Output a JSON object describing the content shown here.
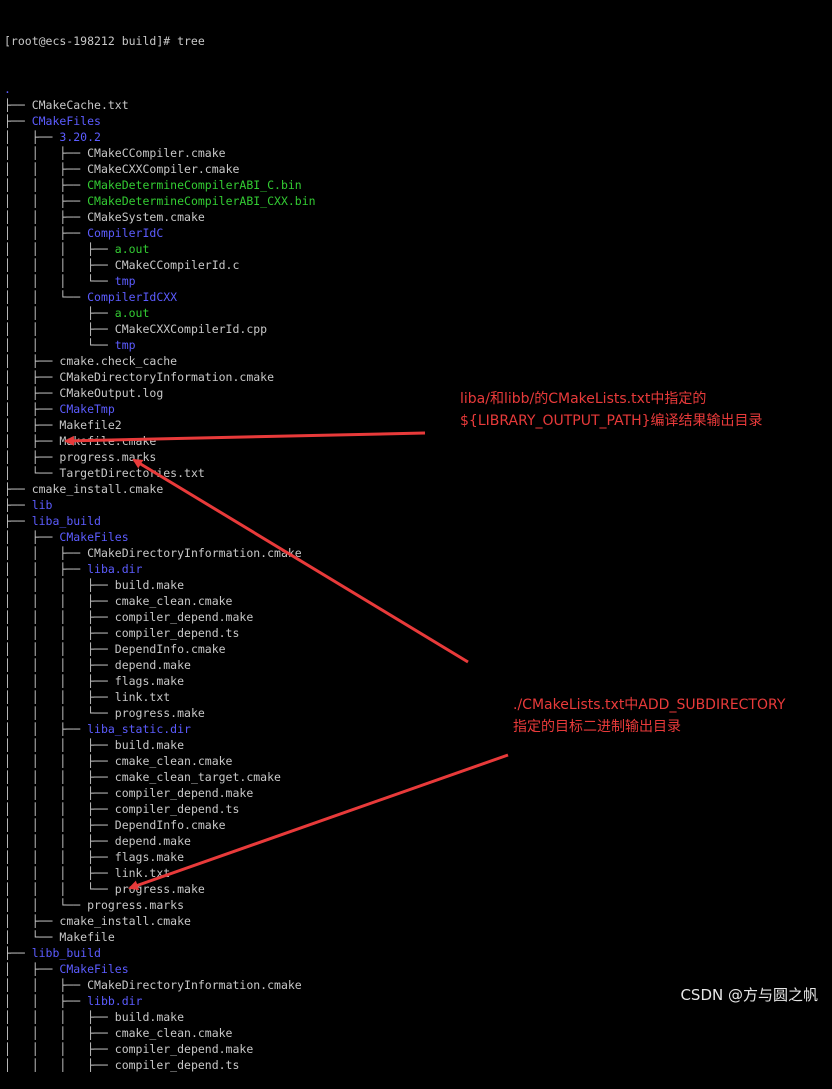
{
  "prompt": "[root@ecs-198212 build]# tree",
  "tree": [
    {
      "prefix": "",
      "name": ".",
      "type": "dir"
    },
    {
      "prefix": "├── ",
      "name": "CMakeCache.txt",
      "type": "file"
    },
    {
      "prefix": "├── ",
      "name": "CMakeFiles",
      "type": "dir"
    },
    {
      "prefix": "│   ├── ",
      "name": "3.20.2",
      "type": "dir"
    },
    {
      "prefix": "│   │   ├── ",
      "name": "CMakeCCompiler.cmake",
      "type": "file"
    },
    {
      "prefix": "│   │   ├── ",
      "name": "CMakeCXXCompiler.cmake",
      "type": "file"
    },
    {
      "prefix": "│   │   ├── ",
      "name": "CMakeDetermineCompilerABI_C.bin",
      "type": "exe"
    },
    {
      "prefix": "│   │   ├── ",
      "name": "CMakeDetermineCompilerABI_CXX.bin",
      "type": "exe"
    },
    {
      "prefix": "│   │   ├── ",
      "name": "CMakeSystem.cmake",
      "type": "file"
    },
    {
      "prefix": "│   │   ├── ",
      "name": "CompilerIdC",
      "type": "dir"
    },
    {
      "prefix": "│   │   │   ├── ",
      "name": "a.out",
      "type": "exe"
    },
    {
      "prefix": "│   │   │   ├── ",
      "name": "CMakeCCompilerId.c",
      "type": "file"
    },
    {
      "prefix": "│   │   │   └── ",
      "name": "tmp",
      "type": "dir"
    },
    {
      "prefix": "│   │   └── ",
      "name": "CompilerIdCXX",
      "type": "dir"
    },
    {
      "prefix": "│   │       ├── ",
      "name": "a.out",
      "type": "exe"
    },
    {
      "prefix": "│   │       ├── ",
      "name": "CMakeCXXCompilerId.cpp",
      "type": "file"
    },
    {
      "prefix": "│   │       └── ",
      "name": "tmp",
      "type": "dir"
    },
    {
      "prefix": "│   ├── ",
      "name": "cmake.check_cache",
      "type": "file"
    },
    {
      "prefix": "│   ├── ",
      "name": "CMakeDirectoryInformation.cmake",
      "type": "file"
    },
    {
      "prefix": "│   ├── ",
      "name": "CMakeOutput.log",
      "type": "file"
    },
    {
      "prefix": "│   ├── ",
      "name": "CMakeTmp",
      "type": "dir"
    },
    {
      "prefix": "│   ├── ",
      "name": "Makefile2",
      "type": "file"
    },
    {
      "prefix": "│   ├── ",
      "name": "Makefile.cmake",
      "type": "file"
    },
    {
      "prefix": "│   ├── ",
      "name": "progress.marks",
      "type": "file"
    },
    {
      "prefix": "│   └── ",
      "name": "TargetDirectories.txt",
      "type": "file"
    },
    {
      "prefix": "├── ",
      "name": "cmake_install.cmake",
      "type": "file"
    },
    {
      "prefix": "├── ",
      "name": "lib",
      "type": "dir"
    },
    {
      "prefix": "├── ",
      "name": "liba_build",
      "type": "dir"
    },
    {
      "prefix": "│   ├── ",
      "name": "CMakeFiles",
      "type": "dir"
    },
    {
      "prefix": "│   │   ├── ",
      "name": "CMakeDirectoryInformation.cmake",
      "type": "file"
    },
    {
      "prefix": "│   │   ├── ",
      "name": "liba.dir",
      "type": "dir"
    },
    {
      "prefix": "│   │   │   ├── ",
      "name": "build.make",
      "type": "file"
    },
    {
      "prefix": "│   │   │   ├── ",
      "name": "cmake_clean.cmake",
      "type": "file"
    },
    {
      "prefix": "│   │   │   ├── ",
      "name": "compiler_depend.make",
      "type": "file"
    },
    {
      "prefix": "│   │   │   ├── ",
      "name": "compiler_depend.ts",
      "type": "file"
    },
    {
      "prefix": "│   │   │   ├── ",
      "name": "DependInfo.cmake",
      "type": "file"
    },
    {
      "prefix": "│   │   │   ├── ",
      "name": "depend.make",
      "type": "file"
    },
    {
      "prefix": "│   │   │   ├── ",
      "name": "flags.make",
      "type": "file"
    },
    {
      "prefix": "│   │   │   ├── ",
      "name": "link.txt",
      "type": "file"
    },
    {
      "prefix": "│   │   │   └── ",
      "name": "progress.make",
      "type": "file"
    },
    {
      "prefix": "│   │   ├── ",
      "name": "liba_static.dir",
      "type": "dir"
    },
    {
      "prefix": "│   │   │   ├── ",
      "name": "build.make",
      "type": "file"
    },
    {
      "prefix": "│   │   │   ├── ",
      "name": "cmake_clean.cmake",
      "type": "file"
    },
    {
      "prefix": "│   │   │   ├── ",
      "name": "cmake_clean_target.cmake",
      "type": "file"
    },
    {
      "prefix": "│   │   │   ├── ",
      "name": "compiler_depend.make",
      "type": "file"
    },
    {
      "prefix": "│   │   │   ├── ",
      "name": "compiler_depend.ts",
      "type": "file"
    },
    {
      "prefix": "│   │   │   ├── ",
      "name": "DependInfo.cmake",
      "type": "file"
    },
    {
      "prefix": "│   │   │   ├── ",
      "name": "depend.make",
      "type": "file"
    },
    {
      "prefix": "│   │   │   ├── ",
      "name": "flags.make",
      "type": "file"
    },
    {
      "prefix": "│   │   │   ├── ",
      "name": "link.txt",
      "type": "file"
    },
    {
      "prefix": "│   │   │   └── ",
      "name": "progress.make",
      "type": "file"
    },
    {
      "prefix": "│   │   └── ",
      "name": "progress.marks",
      "type": "file"
    },
    {
      "prefix": "│   ├── ",
      "name": "cmake_install.cmake",
      "type": "file"
    },
    {
      "prefix": "│   └── ",
      "name": "Makefile",
      "type": "file"
    },
    {
      "prefix": "├── ",
      "name": "libb_build",
      "type": "dir"
    },
    {
      "prefix": "│   ├── ",
      "name": "CMakeFiles",
      "type": "dir"
    },
    {
      "prefix": "│   │   ├── ",
      "name": "CMakeDirectoryInformation.cmake",
      "type": "file"
    },
    {
      "prefix": "│   │   ├── ",
      "name": "libb.dir",
      "type": "dir"
    },
    {
      "prefix": "│   │   │   ├── ",
      "name": "build.make",
      "type": "file"
    },
    {
      "prefix": "│   │   │   ├── ",
      "name": "cmake_clean.cmake",
      "type": "file"
    },
    {
      "prefix": "│   │   │   ├── ",
      "name": "compiler_depend.make",
      "type": "file"
    },
    {
      "prefix": "│   │   │   ├── ",
      "name": "compiler_depend.ts",
      "type": "file"
    }
  ],
  "annotations": {
    "note1_line1": "liba/和libb/的CMakeLists.txt中指定的",
    "note1_line2": "${LIBRARY_OUTPUT_PATH}编译结果输出目录",
    "note2_line1": "./CMakeLists.txt中ADD_SUBDIRECTORY",
    "note2_line2": "指定的目标二进制输出目录"
  },
  "watermark": "CSDN @方与圆之帆",
  "colors": {
    "background": "#000000",
    "directory": "#5c5cff",
    "executable": "#33cc33",
    "file": "#c8c8c8",
    "annotation": "#e83a3a"
  }
}
